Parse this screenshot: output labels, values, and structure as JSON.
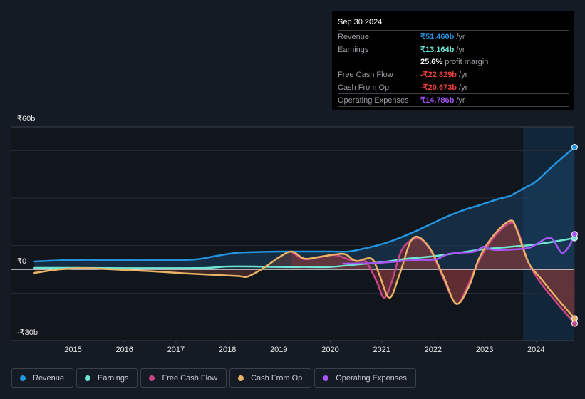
{
  "tooltip": {
    "date": "Sep 30 2024",
    "rows": [
      {
        "label": "Revenue",
        "value": "₹51.460b",
        "unit": "/yr",
        "color": "#2394df"
      },
      {
        "label": "Earnings",
        "value": "₹13.164b",
        "unit": "/yr",
        "color": "#6ee6d4"
      },
      {
        "label": "",
        "value": "25.6%",
        "unit": "profit margin",
        "color": "#ffffff"
      },
      {
        "label": "Free Cash Flow",
        "value": "-₹22.829b",
        "unit": "/yr",
        "color": "#e8403c"
      },
      {
        "label": "Cash From Op",
        "value": "-₹20.673b",
        "unit": "/yr",
        "color": "#e8403c"
      },
      {
        "label": "Operating Expenses",
        "value": "₹14.786b",
        "unit": "/yr",
        "color": "#a855f7"
      }
    ]
  },
  "legend": [
    {
      "label": "Revenue",
      "color": "#2394df"
    },
    {
      "label": "Earnings",
      "color": "#6ee6d4"
    },
    {
      "label": "Free Cash Flow",
      "color": "#c84686"
    },
    {
      "label": "Cash From Op",
      "color": "#e9b264"
    },
    {
      "label": "Operating Expenses",
      "color": "#a855f7"
    }
  ],
  "chart_data": {
    "type": "line",
    "title": "",
    "xlabel": "",
    "ylabel": "",
    "currency": "₹",
    "ylim": [
      -30,
      60
    ],
    "yticks": [
      {
        "value": 60,
        "label": "₹60b"
      },
      {
        "value": 0,
        "label": "₹0"
      },
      {
        "value": -30,
        "label": "-₹30b"
      }
    ],
    "xlim": [
      2014.25,
      2024.75
    ],
    "xticks": [
      2015,
      2016,
      2017,
      2018,
      2019,
      2020,
      2021,
      2022,
      2023,
      2024
    ],
    "highlight_start": 2023.75,
    "grid": true,
    "series": [
      {
        "name": "Revenue",
        "color": "#2394df",
        "fill": true,
        "points": [
          [
            2014.25,
            3.3
          ],
          [
            2014.75,
            3.8
          ],
          [
            2015.25,
            4.0
          ],
          [
            2015.75,
            3.9
          ],
          [
            2016.25,
            3.8
          ],
          [
            2016.75,
            3.9
          ],
          [
            2017.25,
            4.0
          ],
          [
            2017.5,
            4.5
          ],
          [
            2017.8,
            5.7
          ],
          [
            2018.2,
            7.0
          ],
          [
            2018.6,
            7.3
          ],
          [
            2019.0,
            7.5
          ],
          [
            2019.5,
            7.5
          ],
          [
            2020.0,
            7.5
          ],
          [
            2020.35,
            7.5
          ],
          [
            2020.6,
            8.5
          ],
          [
            2020.9,
            10.0
          ],
          [
            2021.2,
            12.0
          ],
          [
            2021.6,
            15.5
          ],
          [
            2022.0,
            19.5
          ],
          [
            2022.3,
            22.5
          ],
          [
            2022.6,
            25.0
          ],
          [
            2022.9,
            27.0
          ],
          [
            2023.25,
            29.5
          ],
          [
            2023.5,
            31.0
          ],
          [
            2023.75,
            34.0
          ],
          [
            2024.0,
            37.0
          ],
          [
            2024.3,
            43.0
          ],
          [
            2024.75,
            51.46
          ]
        ]
      },
      {
        "name": "Earnings",
        "color": "#6ee6d4",
        "fill": false,
        "points": [
          [
            2014.25,
            0.6
          ],
          [
            2015.0,
            0.6
          ],
          [
            2016.0,
            0.5
          ],
          [
            2017.0,
            0.5
          ],
          [
            2017.6,
            0.6
          ],
          [
            2018.0,
            1.2
          ],
          [
            2018.5,
            1.2
          ],
          [
            2019.0,
            1.0
          ],
          [
            2019.5,
            1.0
          ],
          [
            2020.0,
            1.0
          ],
          [
            2020.5,
            2.0
          ],
          [
            2021.0,
            3.0
          ],
          [
            2021.5,
            4.5
          ],
          [
            2022.0,
            5.5
          ],
          [
            2022.5,
            7.0
          ],
          [
            2023.0,
            8.5
          ],
          [
            2023.5,
            9.5
          ],
          [
            2024.0,
            10.5
          ],
          [
            2024.75,
            13.164
          ]
        ]
      },
      {
        "name": "Free Cash Flow",
        "color": "#c84686",
        "fill": true,
        "points": [
          [
            2019.25,
            7.3
          ],
          [
            2019.5,
            4.3
          ],
          [
            2019.8,
            5.2
          ],
          [
            2020.1,
            6.0
          ],
          [
            2020.35,
            4.2
          ],
          [
            2020.55,
            3.5
          ],
          [
            2020.7,
            3.0
          ],
          [
            2020.9,
            -5.0
          ],
          [
            2021.05,
            -12.0
          ],
          [
            2021.2,
            -5.0
          ],
          [
            2021.4,
            8.5
          ],
          [
            2021.7,
            13.0
          ],
          [
            2021.95,
            8.0
          ],
          [
            2022.2,
            -4.0
          ],
          [
            2022.45,
            -14.5
          ],
          [
            2022.65,
            -8.0
          ],
          [
            2022.9,
            4.0
          ],
          [
            2023.2,
            14.0
          ],
          [
            2023.5,
            19.5
          ],
          [
            2023.65,
            16.0
          ],
          [
            2023.85,
            3.0
          ],
          [
            2024.1,
            -6.0
          ],
          [
            2024.4,
            -14.0
          ],
          [
            2024.75,
            -22.829
          ]
        ]
      },
      {
        "name": "Cash From Op",
        "color": "#e9b264",
        "fill": true,
        "points": [
          [
            2014.25,
            -1.5
          ],
          [
            2014.75,
            0.0
          ],
          [
            2015.25,
            0.5
          ],
          [
            2015.75,
            0.0
          ],
          [
            2016.5,
            -0.8
          ],
          [
            2017.25,
            -1.8
          ],
          [
            2017.8,
            -2.4
          ],
          [
            2018.2,
            -2.8
          ],
          [
            2018.4,
            -3.0
          ],
          [
            2018.7,
            0.5
          ],
          [
            2019.0,
            5.0
          ],
          [
            2019.25,
            7.5
          ],
          [
            2019.5,
            4.5
          ],
          [
            2019.8,
            5.3
          ],
          [
            2020.1,
            6.3
          ],
          [
            2020.3,
            6.3
          ],
          [
            2020.5,
            3.5
          ],
          [
            2020.8,
            4.5
          ],
          [
            2020.95,
            -2.0
          ],
          [
            2021.15,
            -12.0
          ],
          [
            2021.35,
            -2.0
          ],
          [
            2021.6,
            13.0
          ],
          [
            2021.9,
            10.0
          ],
          [
            2022.2,
            -3.0
          ],
          [
            2022.45,
            -14.5
          ],
          [
            2022.7,
            -7.0
          ],
          [
            2022.9,
            5.0
          ],
          [
            2023.2,
            15.0
          ],
          [
            2023.5,
            20.5
          ],
          [
            2023.62,
            17.0
          ],
          [
            2023.85,
            3.0
          ],
          [
            2024.1,
            -4.0
          ],
          [
            2024.4,
            -12.0
          ],
          [
            2024.75,
            -20.673
          ]
        ]
      },
      {
        "name": "Operating Expenses",
        "color": "#a855f7",
        "fill": false,
        "points": [
          [
            2020.25,
            2.4
          ],
          [
            2020.75,
            2.5
          ],
          [
            2021.0,
            2.8
          ],
          [
            2021.4,
            3.5
          ],
          [
            2021.75,
            4.0
          ],
          [
            2022.05,
            4.2
          ],
          [
            2022.3,
            6.5
          ],
          [
            2022.55,
            7.0
          ],
          [
            2022.8,
            7.5
          ],
          [
            2022.98,
            9.5
          ],
          [
            2023.15,
            8.3
          ],
          [
            2023.5,
            8.3
          ],
          [
            2023.85,
            9.0
          ],
          [
            2024.0,
            10.5
          ],
          [
            2024.2,
            13.0
          ],
          [
            2024.33,
            12.5
          ],
          [
            2024.5,
            7.0
          ],
          [
            2024.65,
            10.0
          ],
          [
            2024.75,
            14.786
          ]
        ]
      }
    ]
  }
}
